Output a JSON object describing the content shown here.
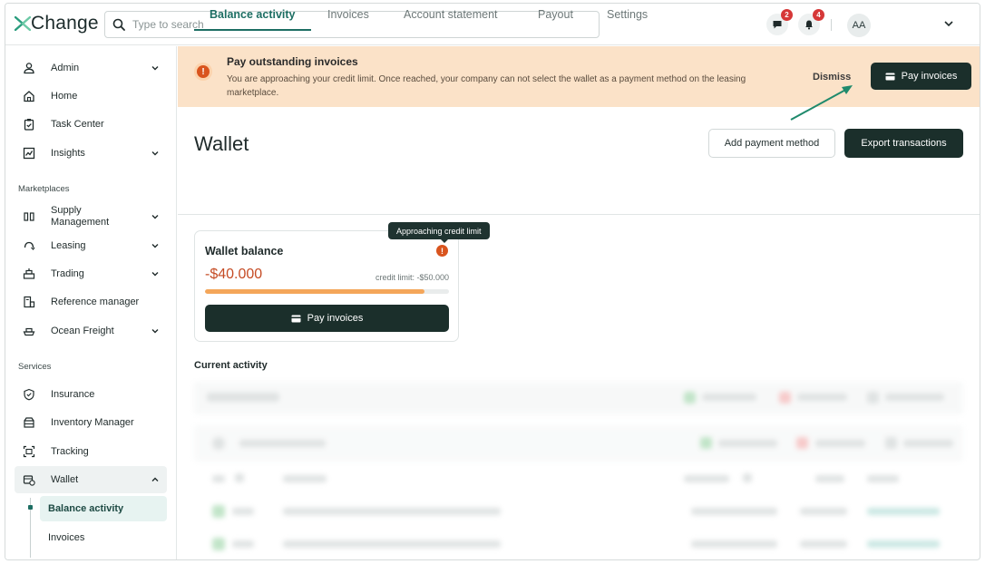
{
  "app": {
    "logo_text": "Change"
  },
  "search": {
    "placeholder": "Type to search",
    "value": ""
  },
  "top": {
    "chat_badge": "2",
    "notif_badge": "4",
    "avatar_initials": "AA"
  },
  "sidebar": {
    "items": [
      {
        "label": "Admin",
        "icon": "user-icon",
        "has_chevron": true
      },
      {
        "label": "Home",
        "icon": "home-icon"
      },
      {
        "label": "Task Center",
        "icon": "clipboard-icon"
      },
      {
        "label": "Insights",
        "icon": "chart-icon",
        "has_chevron": true
      }
    ],
    "marketplaces_title": "Marketplaces",
    "marketplaces": [
      {
        "label": "Supply Management",
        "label_line1": "Supply",
        "label_line2": "Management",
        "icon": "columns-icon",
        "has_chevron": true
      },
      {
        "label": "Leasing",
        "icon": "leasing-icon",
        "has_chevron": true
      },
      {
        "label": "Trading",
        "icon": "trading-icon",
        "has_chevron": true
      },
      {
        "label": "Reference manager",
        "icon": "reference-icon"
      },
      {
        "label": "Ocean Freight",
        "icon": "ship-icon",
        "has_chevron": true
      }
    ],
    "services_title": "Services",
    "services": [
      {
        "label": "Insurance",
        "icon": "shield-icon"
      },
      {
        "label": "Inventory Manager",
        "icon": "inventory-icon"
      },
      {
        "label": "Tracking",
        "icon": "tracking-icon"
      },
      {
        "label": "Wallet",
        "icon": "wallet-icon",
        "has_chevron": true,
        "expanded": true
      }
    ],
    "wallet_sub": [
      {
        "label": "Balance activity",
        "active": true
      },
      {
        "label": "Invoices"
      }
    ]
  },
  "banner": {
    "title": "Pay outstanding invoices",
    "text": "You are approaching your credit limit. Once reached, your company can not select the wallet as a payment method on the leasing marketplace.",
    "dismiss_label": "Dismiss",
    "pay_label": "Pay invoices",
    "bg_color": "#fbe2c8",
    "icon_color": "#d9541e"
  },
  "page": {
    "title": "Wallet",
    "add_payment_label": "Add payment method",
    "export_label": "Export transactions"
  },
  "tabs": [
    {
      "label": "Balance activity",
      "active": true
    },
    {
      "label": "Invoices"
    },
    {
      "label": "Account statement"
    },
    {
      "label": "Payout"
    },
    {
      "label": "Settings"
    }
  ],
  "wallet_card": {
    "title": "Wallet balance",
    "amount": "-$40.000",
    "credit_limit": "credit limit: -$50.000",
    "usage_fraction": 0.9,
    "pay_label": "Pay invoices",
    "tooltip": "Approaching credit limit",
    "amount_color": "#c54b24",
    "bar_color": "#f4a65a"
  },
  "activity": {
    "title": "Current activity"
  },
  "colors": {
    "accent": "#1d6e63",
    "dark_button": "#1b2f2b"
  }
}
